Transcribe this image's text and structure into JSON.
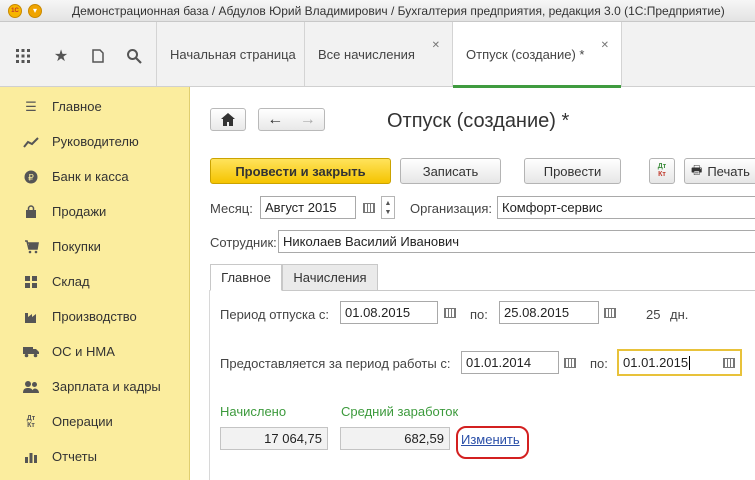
{
  "window": {
    "title": "Демонстрационная база / Абдулов Юрий Владимирович / Бухгалтерия предприятия, редакция 3.0  (1С:Предприятие)",
    "logo_text": "1С"
  },
  "tabs": [
    {
      "label": "Начальная страница",
      "closable": false
    },
    {
      "label": "Все начисления",
      "closable": true
    },
    {
      "label": "Отпуск (создание) *",
      "closable": true
    }
  ],
  "sidebar": {
    "items": [
      {
        "label": "Главное",
        "icon": "menu-lines-icon"
      },
      {
        "label": "Руководителю",
        "icon": "trend-chart-icon"
      },
      {
        "label": "Банк и касса",
        "icon": "ruble-coin-icon"
      },
      {
        "label": "Продажи",
        "icon": "shopping-bag-icon"
      },
      {
        "label": "Покупки",
        "icon": "shopping-cart-icon"
      },
      {
        "label": "Склад",
        "icon": "warehouse-icon"
      },
      {
        "label": "Производство",
        "icon": "factory-icon"
      },
      {
        "label": "ОС и НМА",
        "icon": "truck-icon"
      },
      {
        "label": "Зарплата и кадры",
        "icon": "people-icon"
      },
      {
        "label": "Операции",
        "icon": "debit-credit-icon"
      },
      {
        "label": "Отчеты",
        "icon": "report-chart-icon"
      }
    ]
  },
  "form": {
    "title": "Отпуск (создание) *",
    "buttons": {
      "post_close": "Провести и закрыть",
      "save": "Записать",
      "post": "Провести",
      "print": "Печать",
      "dtkt_label": "Дт Кт"
    },
    "month_label": "Месяц:",
    "month_value": "Август 2015",
    "org_label": "Организация:",
    "org_value": "Комфорт-сервис",
    "employee_label": "Сотрудник:",
    "employee_value": "Николаев Василий Иванович",
    "tabs": [
      "Главное",
      "Начисления"
    ],
    "period_from_label": "Период отпуска с:",
    "period_from": "01.08.2015",
    "period_to_label": "по:",
    "period_to": "25.08.2015",
    "days_count": "25",
    "days_unit": "дн.",
    "work_period_label": "Предоставляется за период работы с:",
    "work_from": "01.01.2014",
    "work_to_label": "по:",
    "work_to": "01.01.2015",
    "accrued_label": "Начислено",
    "accrued_value": "17 064,75",
    "avg_label": "Средний заработок",
    "avg_value": "682,59",
    "change_link": "Изменить"
  }
}
